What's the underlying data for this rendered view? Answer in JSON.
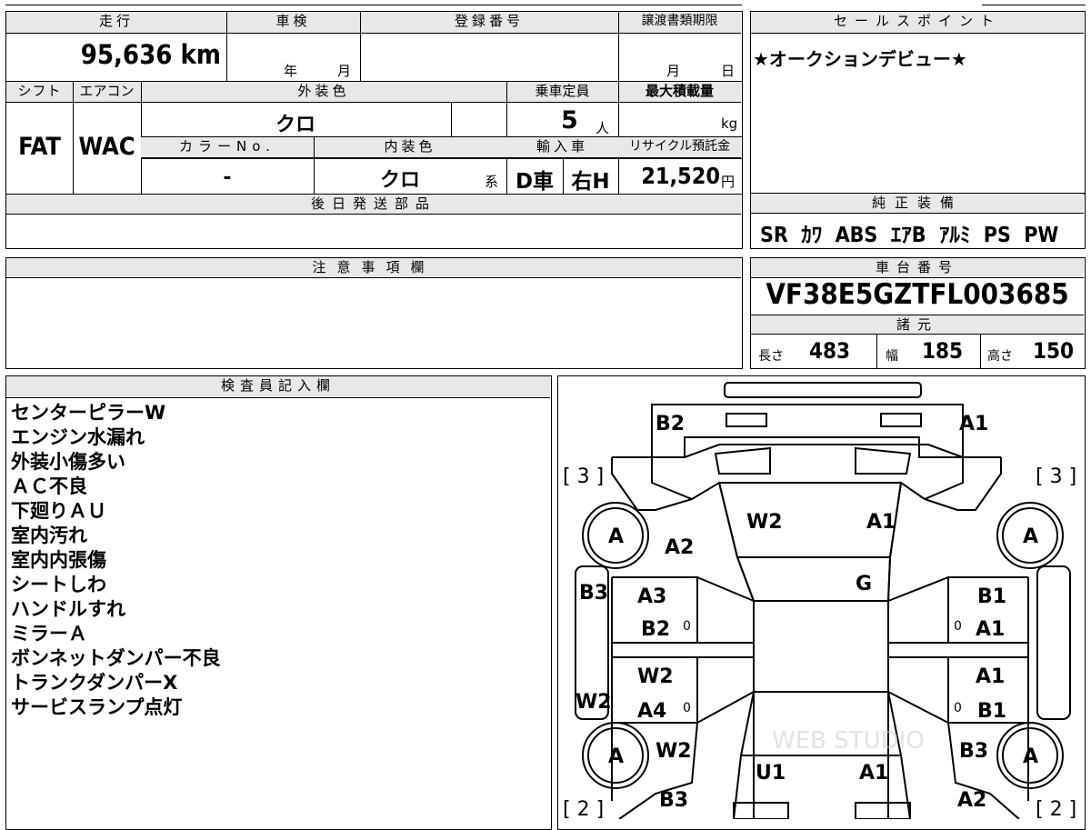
{
  "sheet": {
    "mileage": {
      "label": "走行",
      "value": "95,636 km"
    },
    "inspection": {
      "label": "車検",
      "year_unit": "年",
      "month_unit": "月"
    },
    "registration": {
      "label": "登録番号",
      "value": ""
    },
    "transfer_deadline": {
      "label": "譲渡書類期限",
      "month_unit": "月",
      "day_unit": "日"
    },
    "shift": {
      "label": "シフト",
      "value": "FAT"
    },
    "aircon": {
      "label": "エアコン",
      "value": "WAC"
    },
    "exterior_color": {
      "label": "外装色",
      "value": "クロ"
    },
    "capacity": {
      "label": "乗車定員",
      "value": "5",
      "unit": "人"
    },
    "max_load": {
      "label": "最大積載量",
      "value": "",
      "unit": "kg"
    },
    "color_no": {
      "label": "カラーNo.",
      "value": "-"
    },
    "interior_color": {
      "label": "内装色",
      "value": "クロ",
      "suffix": "系"
    },
    "import": {
      "label": "輸入車",
      "value1": "D車",
      "value2": "右H"
    },
    "recycle": {
      "label": "リサイクル預託金",
      "value": "21,520",
      "unit": "円"
    },
    "later_parts": {
      "label": "後日発送部品",
      "value": ""
    },
    "notice": {
      "label": "注意事項欄",
      "value": ""
    }
  },
  "sales_point": {
    "label": "セールスポイント",
    "value": "★オークションデビュー★"
  },
  "genuine_equipment": {
    "label": "純正装備",
    "value": "SR  ｶﾜ  ABS  ｴｱB  ｱﾙﾐ  PS  PW"
  },
  "chassis": {
    "label": "車台番号",
    "value": "VF38E5GZTFL003685"
  },
  "specs": {
    "label": "諸元",
    "length_label": "長さ",
    "length": "483",
    "width_label": "幅",
    "width": "185",
    "height_label": "高さ",
    "height": "150"
  },
  "inspector": {
    "label": "検査員記入欄",
    "notes": [
      "センターピラーW",
      "エンジン水漏れ",
      "外装小傷多い",
      "ＡＣ不良",
      "下廻りＡＵ",
      "室内汚れ",
      "室内内張傷",
      "シートしわ",
      "ハンドルすれ",
      "ミラーＡ",
      "ボンネットダンパー不良",
      "トランクダンパーX",
      "サービスランプ点灯"
    ]
  },
  "diagram": {
    "rear_left": "B2",
    "rear_right": "A1",
    "tire_left_top": "[ 3 ]",
    "tire_right_top": "[ 3 ]",
    "tire_left_bottom": "[ 2 ]",
    "tire_right_bottom": "[ 2 ]",
    "wheel": "A",
    "rear_glass_l": "W2",
    "rear_glass_r": "A1",
    "roof": "G",
    "a2_left": "A2",
    "b3_left": "B3",
    "w2_left": "W2",
    "ldoor_rear_top": "A3",
    "ldoor_rear_bottom": "B2",
    "ldoor_front_top": "W2",
    "ldoor_front_bottom": "A4",
    "rdoor_rear_top": "B1",
    "rdoor_rear_bottom": "A1",
    "rdoor_front_top": "A1",
    "rdoor_front_bottom": "B1",
    "zero": "0",
    "w2_front_left": "W2",
    "b3_front_left": "B3",
    "b3_front_right": "B3",
    "a2_front_right": "A2",
    "hood_l": "U1",
    "hood_r": "A1",
    "watermark": "WEB STUDIO"
  }
}
